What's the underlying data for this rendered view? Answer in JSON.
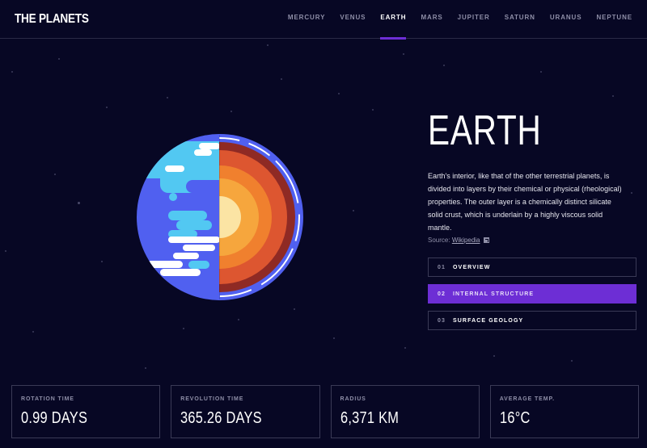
{
  "logo": "THE PLANETS",
  "nav": {
    "items": [
      "MERCURY",
      "VENUS",
      "EARTH",
      "MARS",
      "JUPITER",
      "SATURN",
      "URANUS",
      "NEPTUNE"
    ],
    "active": "EARTH"
  },
  "planet": {
    "name": "EARTH",
    "description": "Earth's interior, like that of the other terrestrial planets, is divided into layers by their chemical or physical (rheological) properties. The outer layer is a chemically distinct silicate solid crust, which is underlain by a highly viscous solid mantle.",
    "source_label": "Source:",
    "source_link": "Wikipedia",
    "source_icon": "external-link-icon"
  },
  "tabs": [
    {
      "num": "01",
      "label": "OVERVIEW"
    },
    {
      "num": "02",
      "label": "INTERNAL STRUCTURE"
    },
    {
      "num": "03",
      "label": "SURFACE GEOLOGY"
    }
  ],
  "active_tab": "INTERNAL STRUCTURE",
  "stats": [
    {
      "label": "ROTATION TIME",
      "value": "0.99 DAYS"
    },
    {
      "label": "REVOLUTION TIME",
      "value": "365.26 DAYS"
    },
    {
      "label": "RADIUS",
      "value": "6,371 KM"
    },
    {
      "label": "AVERAGE TEMP.",
      "value": "16°C"
    }
  ],
  "colors": {
    "background": "#070724",
    "accent": "#6d2ed5",
    "border": "#3a3a56",
    "muted_text": "#8e8ea7"
  }
}
